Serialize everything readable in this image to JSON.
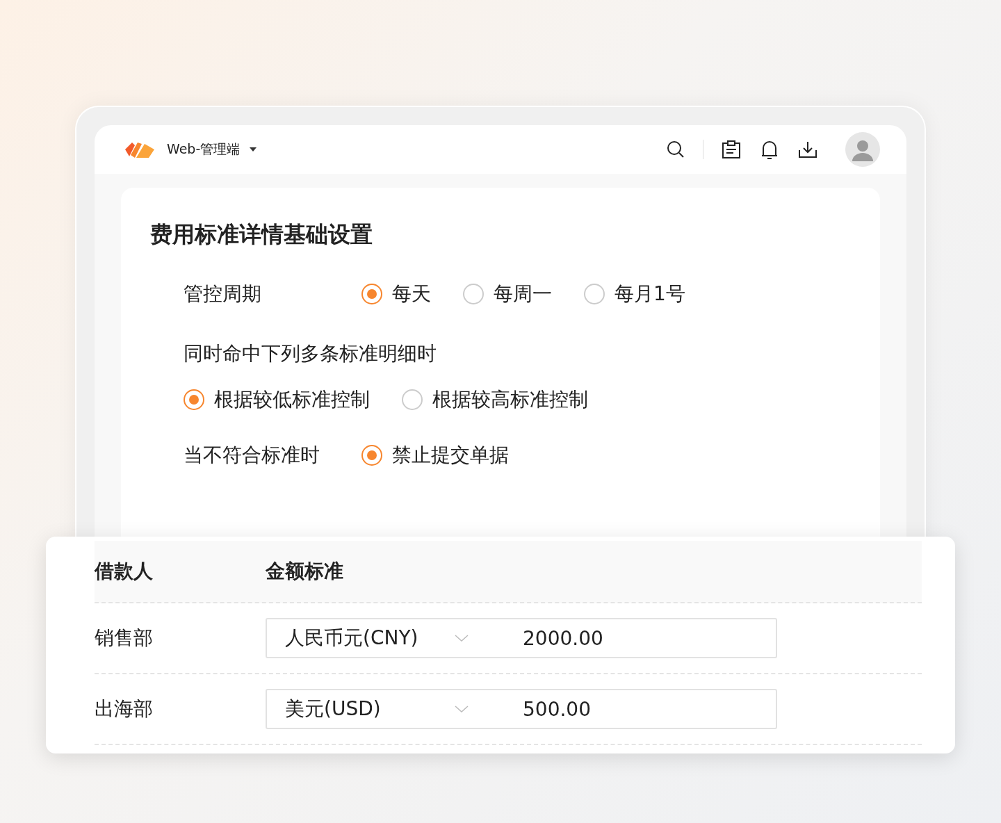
{
  "header": {
    "app_name": "Web-管理端"
  },
  "panel": {
    "title": "费用标准详情基础设置",
    "cycle": {
      "label": "管控周期",
      "options": [
        {
          "label": "每天",
          "selected": true
        },
        {
          "label": "每周一",
          "selected": false
        },
        {
          "label": "每月1号",
          "selected": false
        }
      ]
    },
    "multi_match": {
      "label": "同时命中下列多条标准明细时",
      "options": [
        {
          "label": "根据较低标准控制",
          "selected": true
        },
        {
          "label": "根据较高标准控制",
          "selected": false
        }
      ]
    },
    "violation": {
      "label": "当不符合标准时",
      "options": [
        {
          "label": "禁止提交单据",
          "selected": true
        }
      ]
    }
  },
  "table": {
    "columns": [
      "借款人",
      "金额标准"
    ],
    "rows": [
      {
        "department": "销售部",
        "currency": "人民币元(CNY)",
        "amount": "2000.00"
      },
      {
        "department": "出海部",
        "currency": "美元(USD)",
        "amount": "500.00"
      }
    ]
  }
}
